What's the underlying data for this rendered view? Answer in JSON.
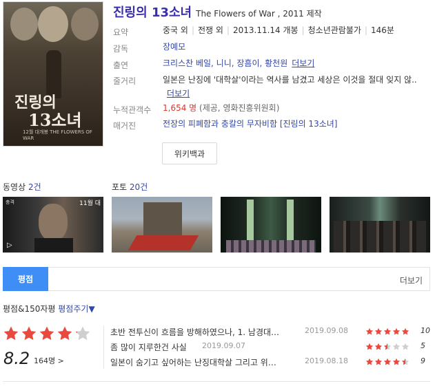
{
  "movie": {
    "title_ko": "진링의 13소녀",
    "title_en": "The Flowers of War , 2011 제작",
    "poster_title_line1": "진링의",
    "poster_title_line2": "13소녀",
    "poster_subtitle": "12월 대개봉 THE FLOWERS OF WAR"
  },
  "info": {
    "summary_label": "요약",
    "summary_country": "중국 외",
    "summary_genre": "전쟁 외",
    "summary_release": "2013.11.14 개봉",
    "summary_rating": "청소년관람불가",
    "summary_runtime": "146분",
    "director_label": "감독",
    "director": "장예모",
    "cast_label": "출연",
    "cast": "크리스찬 베일, 니니, 장흠이, 황천원",
    "more": "더보기",
    "plot_label": "줄거리",
    "plot": "일본은 난징에 '대학살'이라는 역사를 남겼고 세상은 이것을 절대 잊지 않..",
    "audience_label": "누적관객수",
    "audience_count": "1,654 명",
    "audience_source": "(제공, 영화진흥위원회)",
    "magazine_label": "매거진",
    "magazine": "전장의 피폐함과 충칼의 무자비함 [진링의 13소녀]",
    "wiki_button": "위키백과"
  },
  "media": {
    "video_label": "동영상",
    "video_count": "2건",
    "photo_label": "포토",
    "photo_count": "20건",
    "video_duration": "11월 대",
    "video_tag": "충격"
  },
  "tabs": {
    "active": "평점",
    "more": "더보기"
  },
  "ratings": {
    "head_label": "평점&150자평",
    "rate_link": "평점주기",
    "score": "8.2",
    "count": "164명 >",
    "star_fill": 4.1,
    "colors": {
      "star": "#e84a3f",
      "star_empty": "#cfcfcf",
      "accent": "#3f8ef5"
    },
    "reviews": [
      {
        "text": "초반 전투신이 흐름을 방해하였으나, 1. 남경대…",
        "date": "2019.09.08",
        "score": "10",
        "stars": 5
      },
      {
        "text": "좀 많이 지루한건 사실",
        "date": "2019.09.07",
        "score": "5",
        "stars": 2.5
      },
      {
        "text": "일본이 숨기고 싶어하는 난징대학살 그리고 위…",
        "date": "2019.08.18",
        "score": "9",
        "stars": 4.5
      }
    ]
  }
}
